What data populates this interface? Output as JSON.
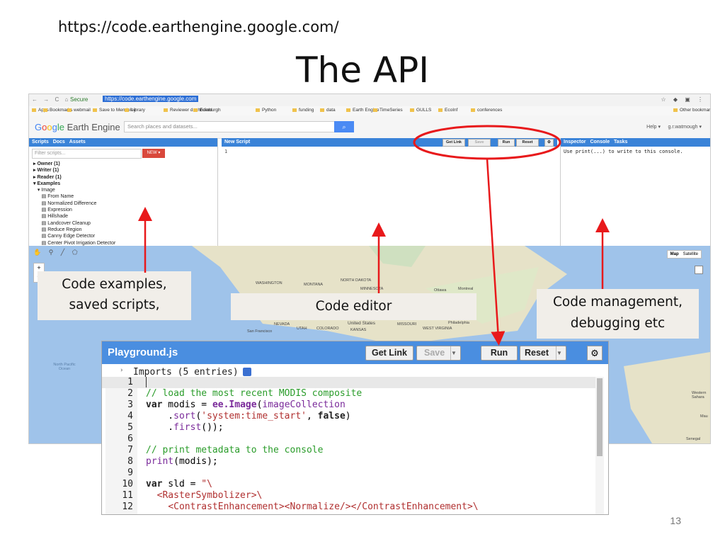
{
  "slide": {
    "url": "https://code.earthengine.google.com/",
    "title": "The API",
    "page_number": "13"
  },
  "browser": {
    "nav_glyphs": "← → C ⌂",
    "secure_label": "Secure",
    "address": "https://code.earthengine.google.com",
    "bookmarks": [
      "Apps",
      "Bookmarks",
      "webmail",
      "Save to Mendeley",
      "Library",
      "Reviewer dashboard",
      "Edinburgh",
      "Python",
      "funding",
      "data",
      "Earth Engine",
      "TimeSeries",
      "GULLS",
      "EcoInf",
      "conferences",
      "Other bookmarks"
    ]
  },
  "ee": {
    "logo_parts": [
      "G",
      "o",
      "o",
      "g",
      "le",
      " Earth Engine"
    ],
    "search_placeholder": "Search places and datasets...",
    "help": "Help ▾",
    "user": "g.r.watmough ▾",
    "left_tabs": [
      "Scripts",
      "Docs",
      "Assets"
    ],
    "filter_placeholder": "Filter scripts...",
    "new_label": "NEW ▾",
    "tree": [
      "▸ Owner (1)",
      "▸ Writer (1)",
      "▸ Reader (1)",
      "▾ Examples",
      "   ▾ Image",
      "      ▤ From Name",
      "      ▤ Normalized Difference",
      "      ▤ Expression",
      "      ▤ Hillshade",
      "      ▤ Landcover Cleanup",
      "      ▤ Reduce Region",
      "      ▤ Canny Edge Detector",
      "      ▤ Center Pivot Irrigation Detector"
    ],
    "editor_title": "New Script",
    "editor_buttons": [
      "Get Link",
      "Save",
      "Run",
      "Reset"
    ],
    "editor_line": "1",
    "right_tabs": [
      "Inspector",
      "Console",
      "Tasks"
    ],
    "console_text": "Use print(...) to write to this console.",
    "map_type": [
      "Map",
      "Satellite"
    ],
    "map_labels": [
      "WASHINGTON",
      "MONTANA",
      "NORTH DAKOTA",
      "MINNESOTA",
      "Ottawa",
      "Montreal",
      "NEVADA",
      "UTAH",
      "COLORADO",
      "KANSAS",
      "United States",
      "MISSOURI",
      "WEST VIRGINIA",
      "Philadelphia",
      "San Francisco",
      "North Pacific Ocean",
      "Western Sahara",
      "Mau",
      "Senegal"
    ]
  },
  "callouts": {
    "left": "Code examples,\nsaved scripts,",
    "middle": "Code editor",
    "right": "Code management,\ndebugging etc"
  },
  "playground": {
    "title": "Playground.js",
    "buttons": [
      "Get Link",
      "Save",
      "Run",
      "Reset"
    ],
    "imports": "Imports (5 entries)",
    "lines": [
      {
        "n": "1",
        "html": ""
      },
      {
        "n": "2",
        "html": "<span class='cm'>// load the most recent MODIS composite</span>"
      },
      {
        "n": "3",
        "html": "<span class='kw'>var</span> modis = <span class='fn'><b>ee.Image</b></span>(<span class='fn'>imageCollection</span>"
      },
      {
        "n": "4",
        "html": "    .<span class='fn'>sort</span>(<span class='str'>'system:time_start'</span>, <span class='kw'>false</span>)"
      },
      {
        "n": "5",
        "html": "    .<span class='fn'>first</span>());"
      },
      {
        "n": "6",
        "html": ""
      },
      {
        "n": "7",
        "html": "<span class='cm'>// print metadata to the console</span>"
      },
      {
        "n": "8",
        "html": "<span class='fn'>print</span>(modis);"
      },
      {
        "n": "9",
        "html": ""
      },
      {
        "n": "10",
        "html": "<span class='kw'>var</span> sld = <span class='str'>\"\\</span>"
      },
      {
        "n": "11",
        "html": "  <span class='xml'>&lt;RasterSymbolizer&gt;\\</span>"
      },
      {
        "n": "12",
        "html": "    <span class='xml'>&lt;ContrastEnhancement&gt;&lt;Normalize/&gt;&lt;/ContrastEnhancement&gt;\\</span>"
      }
    ]
  },
  "colors": {
    "arrow": "#e8191b",
    "panel_header": "#3a83d8",
    "map_water": "#9fc3ea",
    "map_land": "#e6e2c8"
  }
}
